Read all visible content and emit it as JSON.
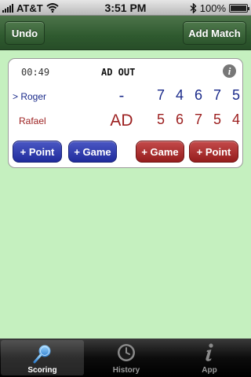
{
  "status_bar": {
    "carrier": "AT&T",
    "time": "3:51 PM",
    "battery": "100%",
    "battery_level": 1.0
  },
  "nav": {
    "undo_label": "Undo",
    "add_match_label": "Add Match"
  },
  "scoreboard": {
    "timer": "00:49",
    "status": "AD OUT",
    "info_icon": "i",
    "players": [
      {
        "name": "> Roger",
        "point": "-",
        "games": [
          "7",
          "4",
          "6",
          "7",
          "5"
        ]
      },
      {
        "name": "Rafael",
        "point": "AD",
        "games": [
          "5",
          "6",
          "7",
          "5",
          "4"
        ]
      }
    ],
    "buttons": {
      "roger_point": "+ Point",
      "roger_game": "+ Game",
      "rafael_game": "+ Game",
      "rafael_point": "+ Point"
    }
  },
  "tabs": [
    {
      "label": "Scoring",
      "icon": "racket-icon",
      "active": true
    },
    {
      "label": "History",
      "icon": "clock-icon",
      "active": false
    },
    {
      "label": "App",
      "icon": "info-icon",
      "active": false
    }
  ],
  "colors": {
    "background": "#c5f0bf",
    "navbar": "#2f5a2f",
    "roger": "#1a2a8a",
    "rafael": "#9c1f1f"
  }
}
